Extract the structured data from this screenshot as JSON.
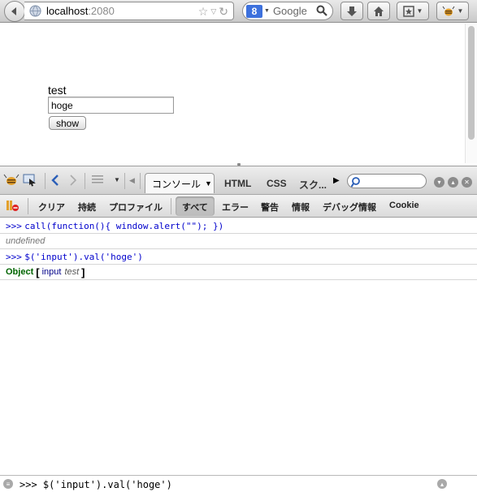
{
  "browser": {
    "url_host": "localhost",
    "url_port": ":2080",
    "search_placeholder": "Google",
    "search_engine_letter": "8"
  },
  "page": {
    "label": "test",
    "input_value": "hoge",
    "button_label": "show"
  },
  "firebug": {
    "tabs": [
      {
        "label": "コンソール",
        "active": true
      },
      {
        "label": "HTML"
      },
      {
        "label": "CSS"
      },
      {
        "label": "スク..."
      }
    ],
    "filters": [
      {
        "label": "クリア"
      },
      {
        "label": "持続"
      },
      {
        "label": "プロファイル"
      },
      {
        "label": "すべて",
        "active": true
      },
      {
        "label": "エラー"
      },
      {
        "label": "警告"
      },
      {
        "label": "情報"
      },
      {
        "label": "デバッグ情報"
      },
      {
        "label": "Cookie"
      }
    ],
    "console": {
      "lines": [
        {
          "prompt": ">>>",
          "text": "call(function(){ window.alert(\"\"); })"
        },
        {
          "text": "undefined"
        },
        {
          "prompt": ">>>",
          "text": "$('input').val('hoge')"
        },
        {
          "object_keyword": "Object",
          "bracket_open": "[",
          "tag": "input",
          "value": "test",
          "bracket_close": "]"
        }
      ]
    },
    "command_line": ">>> $('input').val('hoge')"
  },
  "colors": {
    "command_text": "#0000cc",
    "object_keyword": "#006400",
    "google_logo": "#3d71dd"
  }
}
